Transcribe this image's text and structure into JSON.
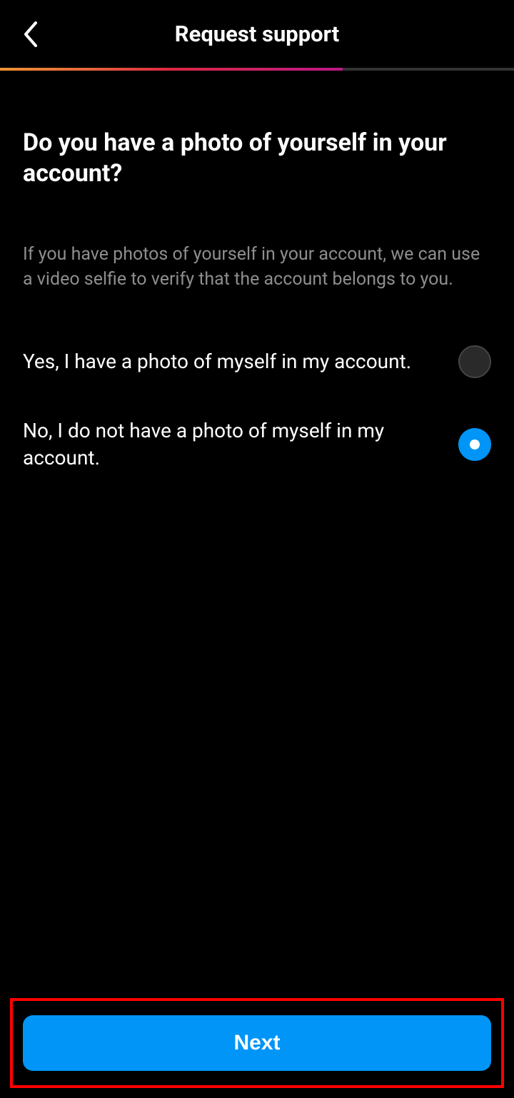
{
  "header": {
    "title": "Request support"
  },
  "content": {
    "question_title": "Do you have a photo of yourself in your account?",
    "question_description": "If you have photos of yourself in your account, we can use a video selfie to verify that the account belongs to you.",
    "options": [
      {
        "label": "Yes, I have a photo of myself in my account.",
        "selected": false
      },
      {
        "label": "No, I do not have a photo of myself in my account.",
        "selected": true
      }
    ]
  },
  "footer": {
    "next_label": "Next"
  }
}
